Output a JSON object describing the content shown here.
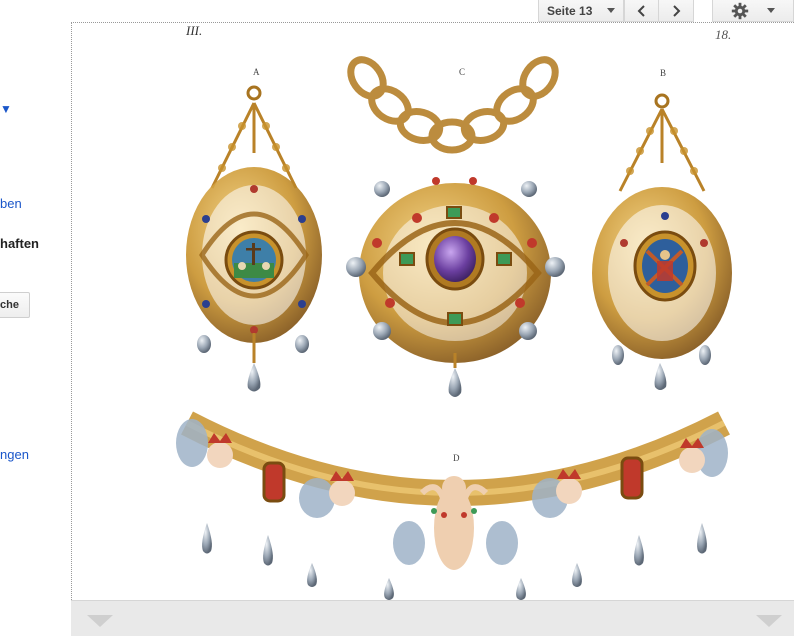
{
  "toolbar": {
    "page_select_label": "Seite 13",
    "prev_icon": "chevron-left-icon",
    "next_icon": "chevron-right-icon",
    "settings_icon": "gear-icon"
  },
  "sidebar": {
    "link_1": "ben",
    "heading": "haften",
    "button_label": "che",
    "link_2": "ngen"
  },
  "plate": {
    "plate_number": "III.",
    "page_number": "18.",
    "label_a": "A",
    "label_b": "B",
    "label_c": "C",
    "label_d": "D"
  },
  "colors": {
    "gold": "#c8922c",
    "gold_dark": "#8a5a14",
    "pearl": "#9aa6b4",
    "red_stone": "#c0392b",
    "amethyst": "#6b3fa0",
    "green_stone": "#3d9a57",
    "link_blue": "#1a56c9"
  }
}
